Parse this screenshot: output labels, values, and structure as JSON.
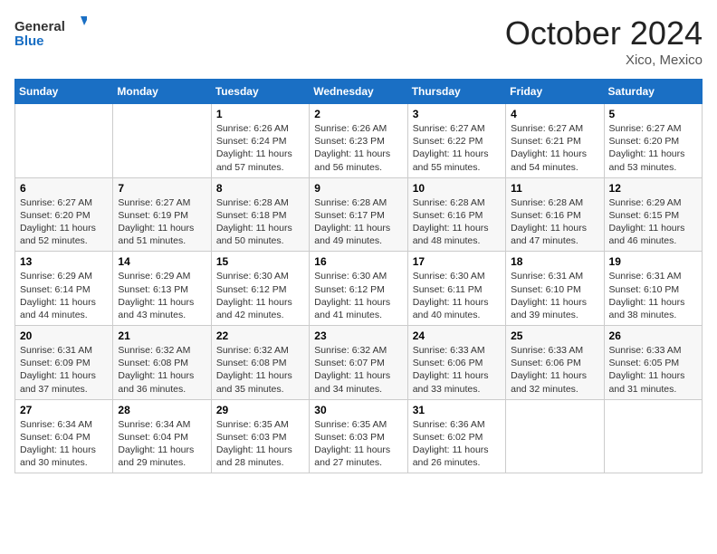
{
  "header": {
    "logo_general": "General",
    "logo_blue": "Blue",
    "month": "October 2024",
    "location": "Xico, Mexico"
  },
  "weekdays": [
    "Sunday",
    "Monday",
    "Tuesday",
    "Wednesday",
    "Thursday",
    "Friday",
    "Saturday"
  ],
  "weeks": [
    [
      {
        "day": "",
        "info": ""
      },
      {
        "day": "",
        "info": ""
      },
      {
        "day": "1",
        "info": "Sunrise: 6:26 AM\nSunset: 6:24 PM\nDaylight: 11 hours and 57 minutes."
      },
      {
        "day": "2",
        "info": "Sunrise: 6:26 AM\nSunset: 6:23 PM\nDaylight: 11 hours and 56 minutes."
      },
      {
        "day": "3",
        "info": "Sunrise: 6:27 AM\nSunset: 6:22 PM\nDaylight: 11 hours and 55 minutes."
      },
      {
        "day": "4",
        "info": "Sunrise: 6:27 AM\nSunset: 6:21 PM\nDaylight: 11 hours and 54 minutes."
      },
      {
        "day": "5",
        "info": "Sunrise: 6:27 AM\nSunset: 6:20 PM\nDaylight: 11 hours and 53 minutes."
      }
    ],
    [
      {
        "day": "6",
        "info": "Sunrise: 6:27 AM\nSunset: 6:20 PM\nDaylight: 11 hours and 52 minutes."
      },
      {
        "day": "7",
        "info": "Sunrise: 6:27 AM\nSunset: 6:19 PM\nDaylight: 11 hours and 51 minutes."
      },
      {
        "day": "8",
        "info": "Sunrise: 6:28 AM\nSunset: 6:18 PM\nDaylight: 11 hours and 50 minutes."
      },
      {
        "day": "9",
        "info": "Sunrise: 6:28 AM\nSunset: 6:17 PM\nDaylight: 11 hours and 49 minutes."
      },
      {
        "day": "10",
        "info": "Sunrise: 6:28 AM\nSunset: 6:16 PM\nDaylight: 11 hours and 48 minutes."
      },
      {
        "day": "11",
        "info": "Sunrise: 6:28 AM\nSunset: 6:16 PM\nDaylight: 11 hours and 47 minutes."
      },
      {
        "day": "12",
        "info": "Sunrise: 6:29 AM\nSunset: 6:15 PM\nDaylight: 11 hours and 46 minutes."
      }
    ],
    [
      {
        "day": "13",
        "info": "Sunrise: 6:29 AM\nSunset: 6:14 PM\nDaylight: 11 hours and 44 minutes."
      },
      {
        "day": "14",
        "info": "Sunrise: 6:29 AM\nSunset: 6:13 PM\nDaylight: 11 hours and 43 minutes."
      },
      {
        "day": "15",
        "info": "Sunrise: 6:30 AM\nSunset: 6:12 PM\nDaylight: 11 hours and 42 minutes."
      },
      {
        "day": "16",
        "info": "Sunrise: 6:30 AM\nSunset: 6:12 PM\nDaylight: 11 hours and 41 minutes."
      },
      {
        "day": "17",
        "info": "Sunrise: 6:30 AM\nSunset: 6:11 PM\nDaylight: 11 hours and 40 minutes."
      },
      {
        "day": "18",
        "info": "Sunrise: 6:31 AM\nSunset: 6:10 PM\nDaylight: 11 hours and 39 minutes."
      },
      {
        "day": "19",
        "info": "Sunrise: 6:31 AM\nSunset: 6:10 PM\nDaylight: 11 hours and 38 minutes."
      }
    ],
    [
      {
        "day": "20",
        "info": "Sunrise: 6:31 AM\nSunset: 6:09 PM\nDaylight: 11 hours and 37 minutes."
      },
      {
        "day": "21",
        "info": "Sunrise: 6:32 AM\nSunset: 6:08 PM\nDaylight: 11 hours and 36 minutes."
      },
      {
        "day": "22",
        "info": "Sunrise: 6:32 AM\nSunset: 6:08 PM\nDaylight: 11 hours and 35 minutes."
      },
      {
        "day": "23",
        "info": "Sunrise: 6:32 AM\nSunset: 6:07 PM\nDaylight: 11 hours and 34 minutes."
      },
      {
        "day": "24",
        "info": "Sunrise: 6:33 AM\nSunset: 6:06 PM\nDaylight: 11 hours and 33 minutes."
      },
      {
        "day": "25",
        "info": "Sunrise: 6:33 AM\nSunset: 6:06 PM\nDaylight: 11 hours and 32 minutes."
      },
      {
        "day": "26",
        "info": "Sunrise: 6:33 AM\nSunset: 6:05 PM\nDaylight: 11 hours and 31 minutes."
      }
    ],
    [
      {
        "day": "27",
        "info": "Sunrise: 6:34 AM\nSunset: 6:04 PM\nDaylight: 11 hours and 30 minutes."
      },
      {
        "day": "28",
        "info": "Sunrise: 6:34 AM\nSunset: 6:04 PM\nDaylight: 11 hours and 29 minutes."
      },
      {
        "day": "29",
        "info": "Sunrise: 6:35 AM\nSunset: 6:03 PM\nDaylight: 11 hours and 28 minutes."
      },
      {
        "day": "30",
        "info": "Sunrise: 6:35 AM\nSunset: 6:03 PM\nDaylight: 11 hours and 27 minutes."
      },
      {
        "day": "31",
        "info": "Sunrise: 6:36 AM\nSunset: 6:02 PM\nDaylight: 11 hours and 26 minutes."
      },
      {
        "day": "",
        "info": ""
      },
      {
        "day": "",
        "info": ""
      }
    ]
  ]
}
